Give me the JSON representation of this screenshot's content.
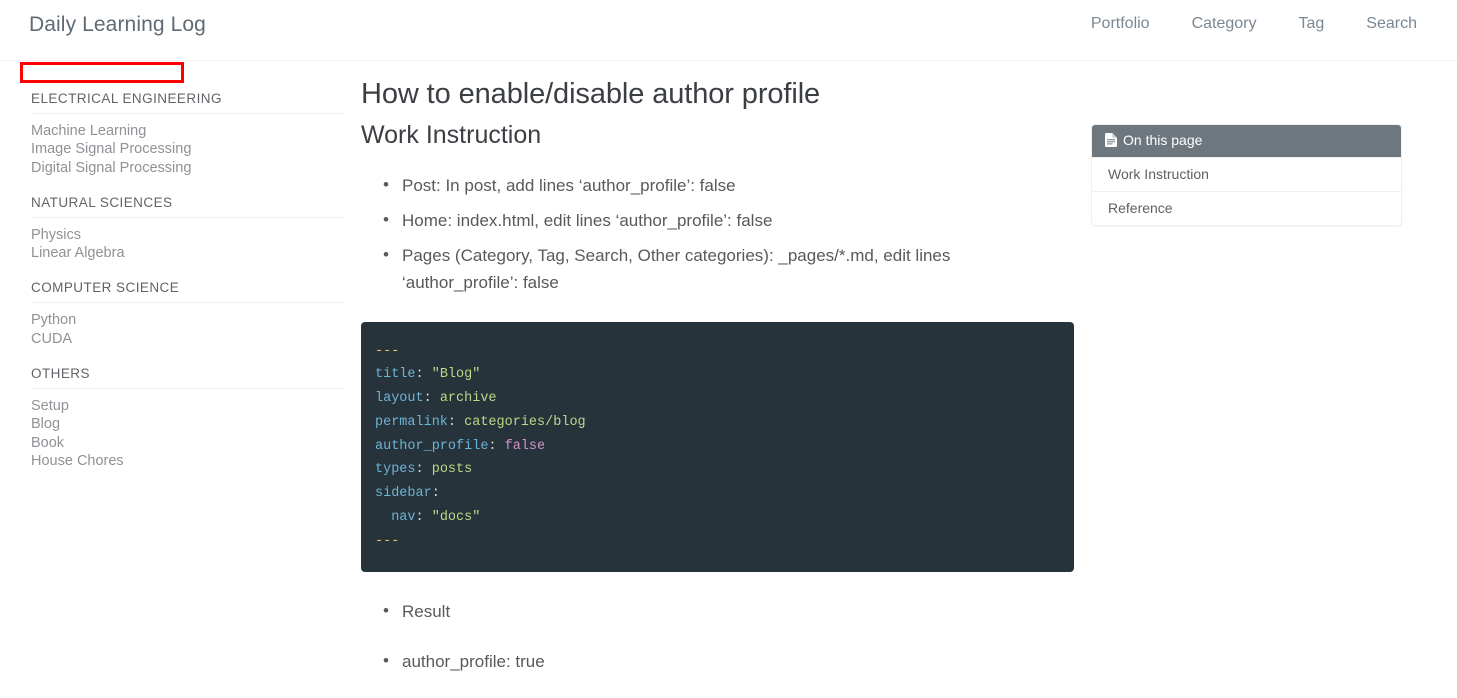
{
  "header": {
    "site_title": "Daily Learning Log",
    "nav": [
      {
        "label": "Portfolio",
        "name": "nav-portfolio"
      },
      {
        "label": "Category",
        "name": "nav-category"
      },
      {
        "label": "Tag",
        "name": "nav-tag"
      },
      {
        "label": "Search",
        "name": "nav-search"
      }
    ]
  },
  "annotation": {
    "type": "red-rectangle-highlight",
    "text": "",
    "color": "#ff0000"
  },
  "sidebar": {
    "groups": [
      {
        "title": "ELECTRICAL ENGINEERING",
        "links": [
          "Machine Learning",
          "Image Signal Processing",
          "Digital Signal Processing"
        ]
      },
      {
        "title": "NATURAL SCIENCES",
        "links": [
          "Physics",
          "Linear Algebra"
        ]
      },
      {
        "title": "COMPUTER SCIENCE",
        "links": [
          "Python",
          "CUDA"
        ]
      },
      {
        "title": "OTHERS",
        "links": [
          "Setup",
          "Blog",
          "Book",
          "House Chores"
        ]
      }
    ]
  },
  "main": {
    "page_title": "How to enable/disable author profile",
    "section_heading": "Work Instruction",
    "bullets": [
      "Post: In post, add lines ‘author_profile’: false",
      "Home: index.html, edit lines ‘author_profile’: false",
      "Pages (Category, Tag, Search, Other categories): _pages/*.md, edit lines ‘author_profile’: false"
    ],
    "code": {
      "language": "yaml",
      "lines": [
        [
          {
            "t": "---",
            "c": "c-dash"
          }
        ],
        [
          {
            "t": "title",
            "c": "c-key"
          },
          {
            "t": ": ",
            "c": "c-punct"
          },
          {
            "t": "\"Blog\"",
            "c": "c-val"
          }
        ],
        [
          {
            "t": "layout",
            "c": "c-key"
          },
          {
            "t": ": ",
            "c": "c-punct"
          },
          {
            "t": "archive",
            "c": "c-val"
          }
        ],
        [
          {
            "t": "permalink",
            "c": "c-key"
          },
          {
            "t": ": ",
            "c": "c-punct"
          },
          {
            "t": "categories/blog",
            "c": "c-val"
          }
        ],
        [
          {
            "t": "author_profile",
            "c": "c-key"
          },
          {
            "t": ": ",
            "c": "c-punct"
          },
          {
            "t": "false",
            "c": "c-bool"
          }
        ],
        [
          {
            "t": "types",
            "c": "c-key"
          },
          {
            "t": ": ",
            "c": "c-punct"
          },
          {
            "t": "posts",
            "c": "c-val"
          }
        ],
        [
          {
            "t": "sidebar",
            "c": "c-key"
          },
          {
            "t": ":",
            "c": "c-punct"
          }
        ],
        [
          {
            "t": "  ",
            "c": "c-punct"
          },
          {
            "t": "nav",
            "c": "c-key"
          },
          {
            "t": ": ",
            "c": "c-punct"
          },
          {
            "t": "\"docs\"",
            "c": "c-val"
          }
        ],
        [
          {
            "t": "---",
            "c": "c-dash"
          }
        ]
      ]
    },
    "bullets_after": [
      "Result",
      "author_profile: true"
    ]
  },
  "toc": {
    "icon": "document-icon",
    "title": "On this page",
    "items": [
      "Work Instruction",
      "Reference"
    ],
    "header_color": "#6f777e"
  }
}
